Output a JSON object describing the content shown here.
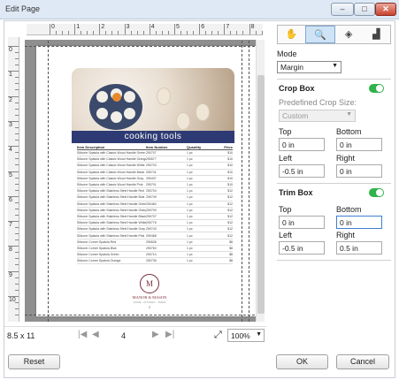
{
  "window": {
    "title": "Edit Page",
    "min_glyph": "–",
    "max_glyph": "□",
    "close_glyph": "✕"
  },
  "rulers": {
    "horizontal": [
      "0",
      "1",
      "2",
      "3",
      "4",
      "5",
      "6",
      "7",
      "8"
    ],
    "vertical": [
      "0",
      "1",
      "2",
      "3",
      "4",
      "5",
      "6",
      "7",
      "8",
      "9",
      "10"
    ]
  },
  "preview": {
    "banner": "cooking tools",
    "columns": [
      "Item Description",
      "Item Number",
      "Quantity",
      "Price"
    ],
    "rows": [
      [
        "Silicone Spatula with Classic Wood Handle Green",
        "250707",
        "1 pc",
        "$10"
      ],
      [
        "Silicone Spatula with Classic Wood Handle Orange",
        "250677",
        "1 pc",
        "$10"
      ],
      [
        "Silicone Spatula with Classic Wood Handle White",
        "250703",
        "1 pc",
        "$10"
      ],
      [
        "Silicone Spatula with Classic Wood Handle Black",
        "250741",
        "1 pc",
        "$10"
      ],
      [
        "Silicone Spatula with Classic Wood Handle Gray",
        "250437",
        "1 pc",
        "$10"
      ],
      [
        "Silicone Spatula with Classic Wood Handle Pink",
        "250701",
        "1 pc",
        "$10"
      ],
      [
        "Silicone Spatula with Stainless Steel Handle Red",
        "250704",
        "1 pc",
        "$12"
      ],
      [
        "Silicone Spatula with Stainless Steel Handle Blue",
        "250749",
        "1 pc",
        "$12"
      ],
      [
        "Silicone Spatula with Stainless Steel Handle Green",
        "250460",
        "1 pc",
        "$12"
      ],
      [
        "Silicone Spatula with Stainless Steel Handle Orange",
        "250709",
        "1 pc",
        "$12"
      ],
      [
        "Silicone Spatula with Stainless Steel Handle Black",
        "250707",
        "1 pc",
        "$12"
      ],
      [
        "Silicone Spatula with Stainless Steel Handle White",
        "250776",
        "1 pc",
        "$12"
      ],
      [
        "Silicone Spatula with Stainless Steel Handle Gray",
        "250743",
        "1 pc",
        "$12"
      ],
      [
        "Silicone Spatula with Stainless Steel Handle Pink",
        "250468",
        "1 pc",
        "$12"
      ],
      [
        "Silicone Corner Spatula Red",
        "250636",
        "1 pc",
        "$8"
      ],
      [
        "Silicone Corner Spatula Blue",
        "250760",
        "1 pc",
        "$8"
      ],
      [
        "Silicone Corner Spatula Green",
        "250714",
        "1 pc",
        "$8"
      ],
      [
        "Silicone Corner Spatula Orange",
        "250735",
        "1 pc",
        "$8"
      ]
    ],
    "logo_mark": "M",
    "logo_name": "MANOR & MASON",
    "logo_sub": "HOME · KITCHEN · TABLE",
    "page_number": "2"
  },
  "statusbar": {
    "page_size": "8.5 x 11",
    "current_page": "4",
    "zoom": "100%",
    "first_glyph": "|◀",
    "prev_glyph": "◀",
    "next_glyph": "▶",
    "last_glyph": "▶|",
    "fit_glyph": "⤢"
  },
  "tools": [
    "✋",
    "🔍",
    "◈",
    "▟"
  ],
  "panel": {
    "mode_label": "Mode",
    "mode_value": "Margin",
    "crop_box": {
      "label": "Crop Box",
      "predefined_label": "Predefined Crop Size:",
      "predefined_value": "Custom",
      "top_label": "Top",
      "top": "0 in",
      "bottom_label": "Bottom",
      "bottom": "0 in",
      "left_label": "Left",
      "left": "-0.5 in",
      "right_label": "Right",
      "right": "0 in"
    },
    "trim_box": {
      "label": "Trim Box",
      "top_label": "Top",
      "top": "0 in",
      "bottom_label": "Bottom",
      "bottom": "0 in",
      "left_label": "Left",
      "left": "-0.5 in",
      "right_label": "Right",
      "right": "0.5 in"
    }
  },
  "buttons": {
    "reset": "Reset",
    "ok": "OK",
    "cancel": "Cancel"
  },
  "colors": {
    "toggle_on": "#2fb34b",
    "banner": "#2d3a73",
    "brand": "#7a2a3a"
  }
}
